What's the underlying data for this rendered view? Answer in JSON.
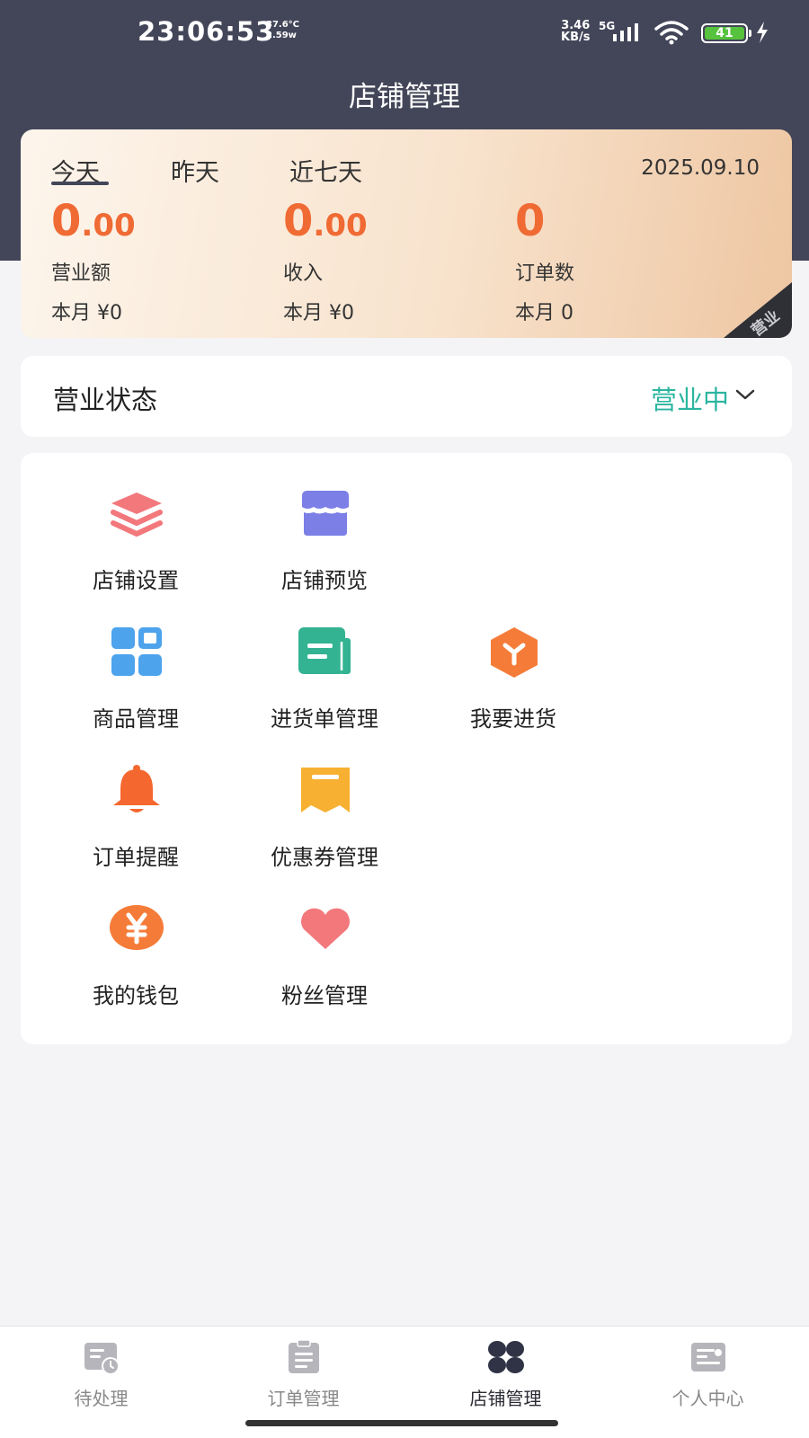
{
  "status_bar": {
    "time": "23:06:53",
    "temp": "37.6°C",
    "power": "2.59w",
    "net_speed": "3.46",
    "net_unit": "KB/s",
    "network": "5G",
    "battery": "41"
  },
  "header": {
    "title": "店铺管理"
  },
  "stats": {
    "tabs": [
      {
        "label": "今天",
        "active": true
      },
      {
        "label": "昨天",
        "active": false
      },
      {
        "label": "近七天",
        "active": false
      }
    ],
    "date": "2025.09.10",
    "items": [
      {
        "value_int": "0",
        "value_dec": ".00",
        "label": "营业额",
        "month": "本月 ¥0"
      },
      {
        "value_int": "0",
        "value_dec": ".00",
        "label": "收入",
        "month": "本月 ¥0"
      },
      {
        "value_int": "0",
        "value_dec": "",
        "label": "订单数",
        "month": "本月 0"
      }
    ],
    "ribbon_text": "营业"
  },
  "business_status": {
    "label": "营业状态",
    "value": "营业中"
  },
  "menu": [
    {
      "label": "店铺设置",
      "icon": "layers-icon",
      "color": "#f2787c"
    },
    {
      "label": "店铺预览",
      "icon": "shop-icon",
      "color": "#7b7fe6"
    },
    {
      "label": "商品管理",
      "icon": "grid-icon",
      "color": "#4da3ec"
    },
    {
      "label": "进货单管理",
      "icon": "document-icon",
      "color": "#33b392"
    },
    {
      "label": "我要进货",
      "icon": "box-icon",
      "color": "#f57c38"
    },
    {
      "label": "订单提醒",
      "icon": "bell-icon",
      "color": "#f4682f"
    },
    {
      "label": "优惠券管理",
      "icon": "coupon-icon",
      "color": "#f7b031"
    },
    {
      "label": "我的钱包",
      "icon": "wallet-icon",
      "color": "#f57c38"
    },
    {
      "label": "粉丝管理",
      "icon": "heart-icon",
      "color": "#f2787c"
    }
  ],
  "bottom_nav": [
    {
      "label": "待处理",
      "icon": "pending-icon",
      "active": false
    },
    {
      "label": "订单管理",
      "icon": "order-icon",
      "active": false
    },
    {
      "label": "店铺管理",
      "icon": "store-icon",
      "active": true
    },
    {
      "label": "个人中心",
      "icon": "profile-icon",
      "active": false
    }
  ],
  "colors": {
    "header": "#434659",
    "accent_orange": "#f06a34",
    "status_green": "#2bb5a0"
  }
}
